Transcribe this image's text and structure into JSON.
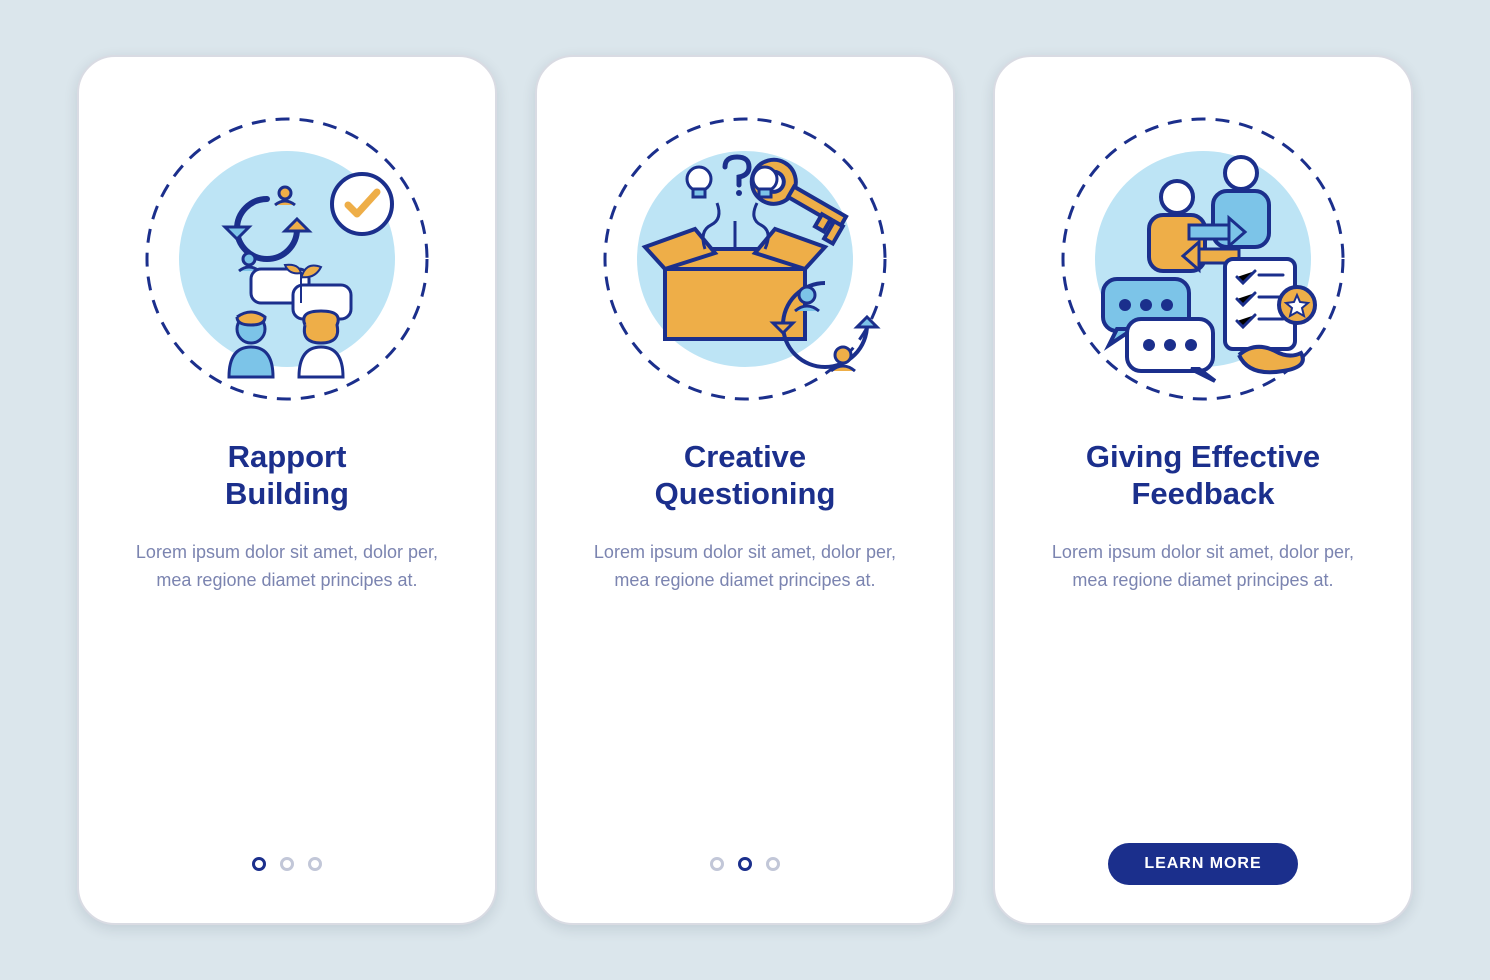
{
  "colors": {
    "navy": "#1b2f8c",
    "orange": "#eeae48",
    "sky": "#7cc4e8",
    "sky_light": "#bde4f5",
    "white": "#ffffff",
    "muted": "#7b84b0",
    "bg": "#dbe6ec"
  },
  "screens": [
    {
      "illustration": "rapport-building-icon",
      "title": "Rapport\nBuilding",
      "body": "Lorem ipsum dolor sit amet, dolor per, mea regione diamet principes at.",
      "page_indicator": {
        "count": 3,
        "active_index": 0
      }
    },
    {
      "illustration": "creative-questioning-icon",
      "title": "Creative\nQuestioning",
      "body": "Lorem ipsum dolor sit amet, dolor per, mea regione diamet principes at.",
      "page_indicator": {
        "count": 3,
        "active_index": 1
      }
    },
    {
      "illustration": "giving-effective-feedback-icon",
      "title": "Giving Effective\nFeedback",
      "body": "Lorem ipsum dolor sit amet, dolor per, mea regione diamet principes at.",
      "cta_label": "LEARN MORE"
    }
  ]
}
